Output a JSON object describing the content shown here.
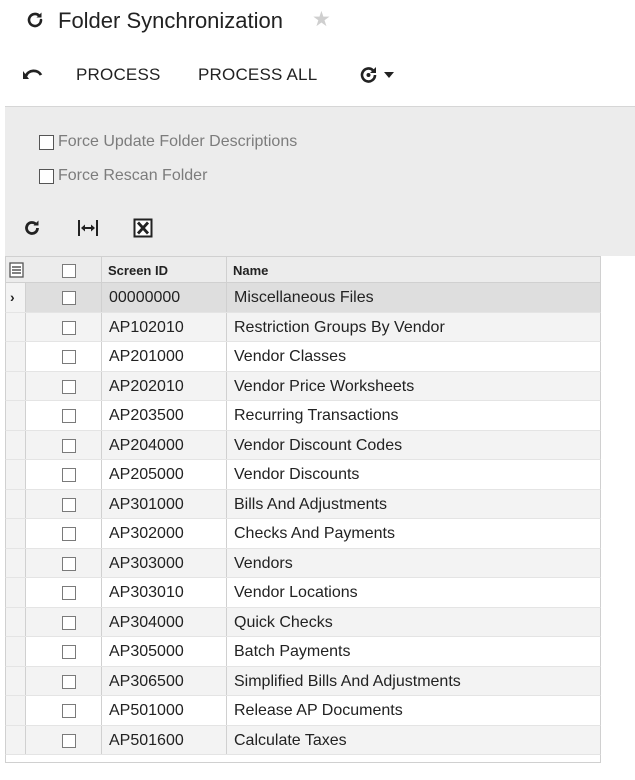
{
  "header": {
    "title": "Folder Synchronization"
  },
  "toolbar": {
    "process_label": "PROCESS",
    "process_all_label": "PROCESS ALL"
  },
  "filters": {
    "force_update_label": "Force Update Folder Descriptions",
    "force_rescan_label": "Force Rescan Folder"
  },
  "grid": {
    "columns": [
      "Screen ID",
      "Name"
    ],
    "rows": [
      {
        "screen_id": "00000000",
        "name": "Miscellaneous Files"
      },
      {
        "screen_id": "AP102010",
        "name": "Restriction Groups By Vendor"
      },
      {
        "screen_id": "AP201000",
        "name": "Vendor Classes"
      },
      {
        "screen_id": "AP202010",
        "name": "Vendor Price Worksheets"
      },
      {
        "screen_id": "AP203500",
        "name": "Recurring Transactions"
      },
      {
        "screen_id": "AP204000",
        "name": "Vendor Discount Codes"
      },
      {
        "screen_id": "AP205000",
        "name": "Vendor Discounts"
      },
      {
        "screen_id": "AP301000",
        "name": "Bills And Adjustments"
      },
      {
        "screen_id": "AP302000",
        "name": "Checks And Payments"
      },
      {
        "screen_id": "AP303000",
        "name": "Vendors"
      },
      {
        "screen_id": "AP303010",
        "name": "Vendor Locations"
      },
      {
        "screen_id": "AP304000",
        "name": "Quick Checks"
      },
      {
        "screen_id": "AP305000",
        "name": "Batch Payments"
      },
      {
        "screen_id": "AP306500",
        "name": "Simplified Bills And Adjustments"
      },
      {
        "screen_id": "AP501000",
        "name": "Release AP Documents"
      },
      {
        "screen_id": "AP501600",
        "name": "Calculate Taxes"
      }
    ]
  },
  "icons": {
    "title": "refresh-icon",
    "favorite": "star-icon",
    "undo": "undo-icon",
    "refresh_menu": "refresh-dropdown-icon",
    "grid_refresh": "refresh-icon",
    "fit_columns": "fit-columns-icon",
    "export": "excel-export-icon",
    "column_settings": "column-settings-icon",
    "row_selector": "chevron-right-icon"
  },
  "colors": {
    "favorite_star": "#cfcfcf",
    "filter_panel_bg": "#ececec",
    "checkbox_label": "#7c7c7c",
    "selected_row_bg": "#dedede"
  }
}
